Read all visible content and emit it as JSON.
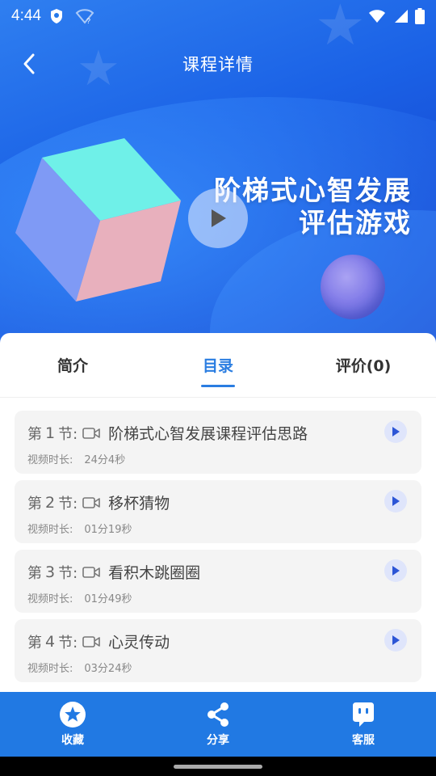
{
  "status_bar": {
    "time": "4:44",
    "icons": [
      "shield-icon",
      "wifi-question-icon",
      "wifi-icon",
      "signal-icon",
      "battery-icon"
    ]
  },
  "header": {
    "title": "课程详情",
    "back_icon": "chevron-left-icon"
  },
  "banner": {
    "title_line1": "阶梯式心智发展",
    "title_line2": "评估游戏",
    "play_icon": "play-icon"
  },
  "tabs": [
    {
      "label": "简介",
      "active": false
    },
    {
      "label": "目录",
      "active": true
    },
    {
      "label": "评价(0)",
      "active": false
    }
  ],
  "lessons": [
    {
      "prefix": "第",
      "num": "1",
      "suffix": "节:",
      "title": "阶梯式心智发展课程评估思路",
      "dur_label": "视频时长:",
      "duration": "24分4秒"
    },
    {
      "prefix": "第",
      "num": "2",
      "suffix": "节:",
      "title": "移杯猜物",
      "dur_label": "视频时长:",
      "duration": "01分19秒"
    },
    {
      "prefix": "第",
      "num": "3",
      "suffix": "节:",
      "title": "看积木跳圈圈",
      "dur_label": "视频时长:",
      "duration": "01分49秒"
    },
    {
      "prefix": "第",
      "num": "4",
      "suffix": "节:",
      "title": "心灵传动",
      "dur_label": "视频时长:",
      "duration": "03分24秒"
    }
  ],
  "bottom_nav": [
    {
      "label": "收藏",
      "icon": "star-icon"
    },
    {
      "label": "分享",
      "icon": "share-icon"
    },
    {
      "label": "客服",
      "icon": "customer-service-icon"
    }
  ],
  "colors": {
    "primary": "#2179e3",
    "active_tab": "#2a7de1",
    "card_bg": "#f4f4f4",
    "header_gradient_start": "#2f7ff0",
    "header_gradient_end": "#1a3fc4"
  }
}
